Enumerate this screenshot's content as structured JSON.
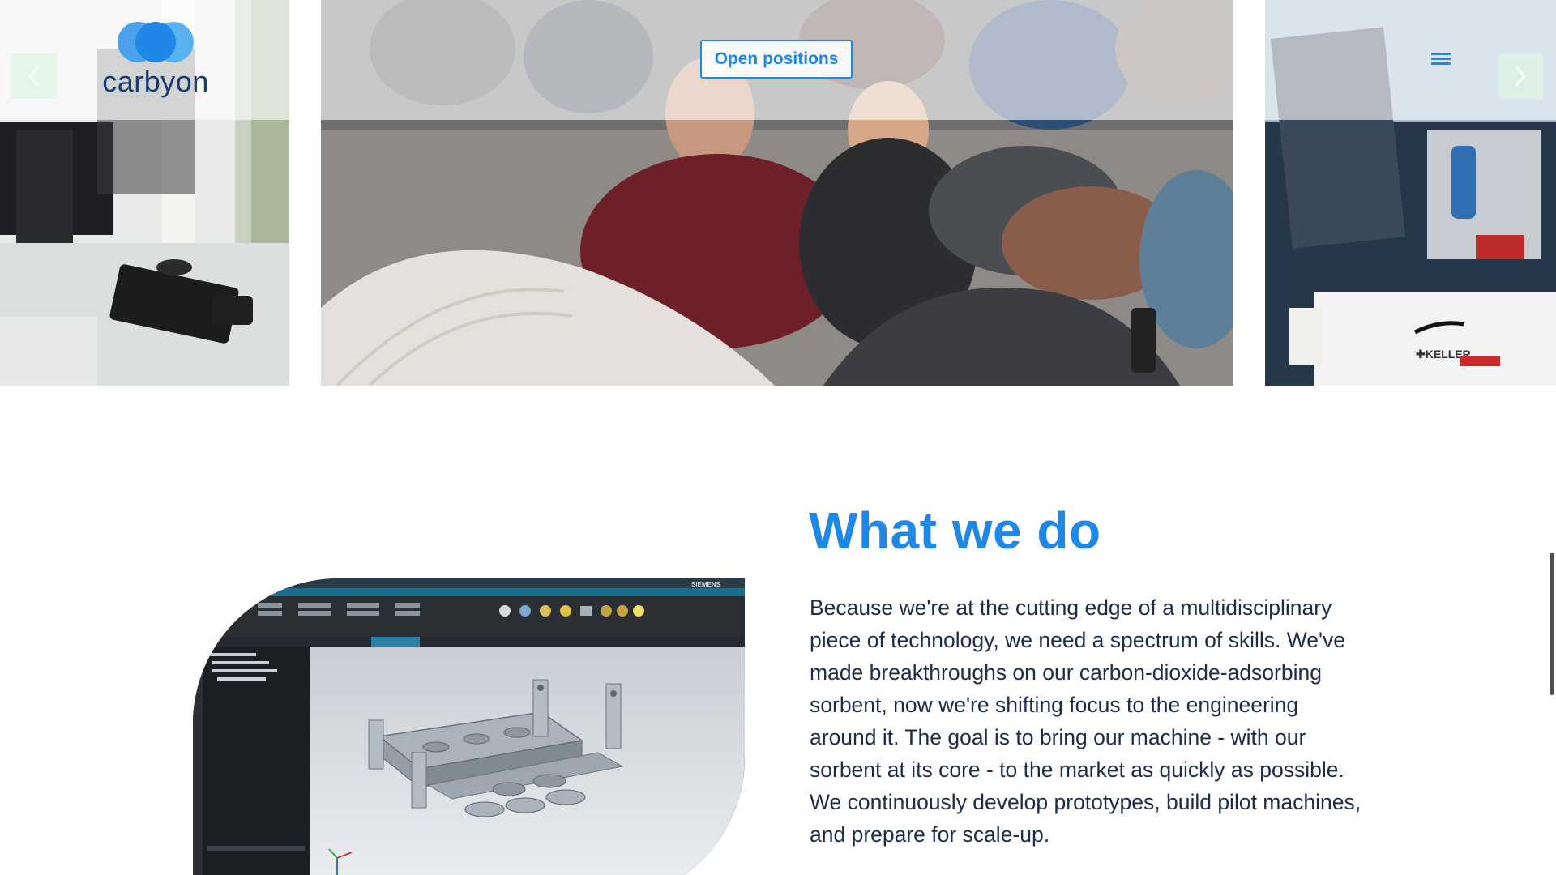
{
  "brand": {
    "name": "carbyon",
    "accent_color": "#1f87e6",
    "text_color": "#17396b"
  },
  "header": {
    "cta_label": "Open positions",
    "menu_icon": "hamburger-menu-icon"
  },
  "carousel": {
    "prev_icon": "chevron-left-icon",
    "next_icon": "chevron-right-icon",
    "slides": [
      {
        "description": "office desk with monitors"
      },
      {
        "description": "team seated in lounge"
      },
      {
        "description": "lab equipment"
      }
    ],
    "right_slide_label": "KELLER"
  },
  "what_we_do": {
    "title": "What we do",
    "body": "Because we're at the cutting edge of a multidisciplinary piece of technology, we need a spectrum of skills. We've made breakthroughs on our carbon-dioxide-adsorbing sorbent, now we're shifting focus to the engineering around it. The goal is to bring our machine - with our sorbent at its core - to the market as quickly as possible. We continuously develop prototypes, build pilot machines, and prepare for scale-up."
  },
  "cad_screenshot": {
    "brand_label": "SIEMENS"
  }
}
